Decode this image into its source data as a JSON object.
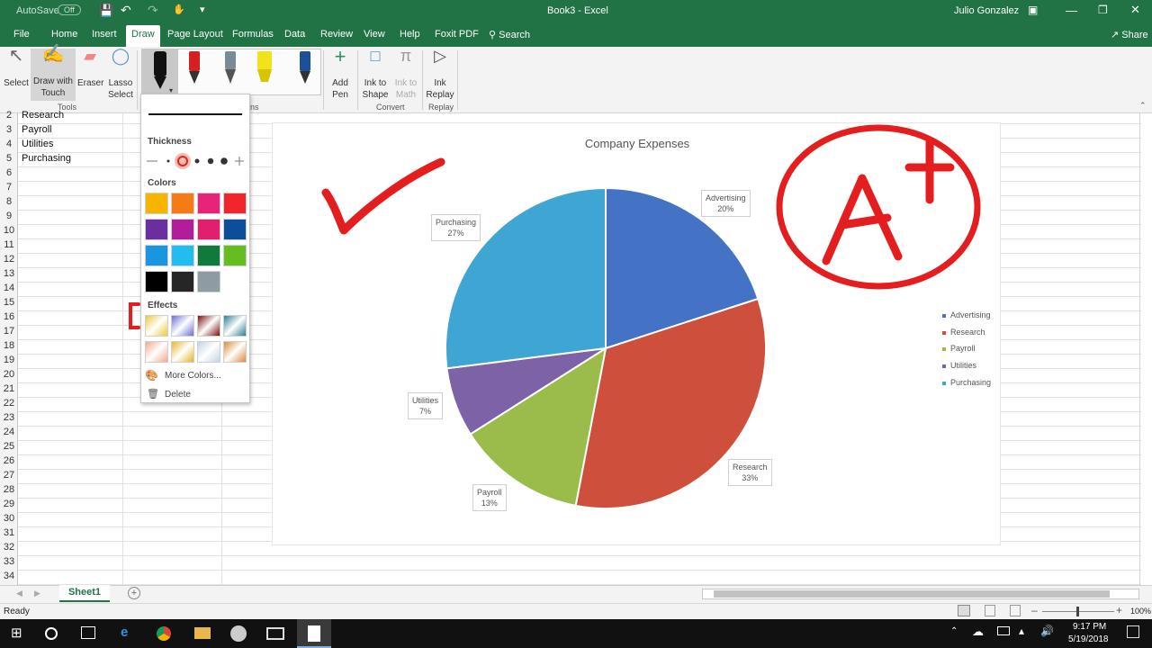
{
  "titlebar": {
    "autosave_label": "AutoSave",
    "autosave_state": "Off",
    "doc_title": "Book3 - Excel",
    "user": "Julio Gonzalez"
  },
  "tabs": [
    "File",
    "Home",
    "Insert",
    "Draw",
    "Page Layout",
    "Formulas",
    "Data",
    "Review",
    "View",
    "Help",
    "Foxit PDF"
  ],
  "search_label": "Search",
  "share_label": "Share",
  "ribbon": {
    "select": "Select",
    "draw_touch": [
      "Draw with",
      "Touch"
    ],
    "eraser": "Eraser",
    "lasso": [
      "Lasso",
      "Select"
    ],
    "tools_group": "Tools",
    "pens_group_fragment": "ns",
    "add_pen": [
      "Add",
      "Pen"
    ],
    "ink_shape": [
      "Ink to",
      "Shape"
    ],
    "ink_math": [
      "Ink to",
      "Math"
    ],
    "ink_replay": [
      "Ink",
      "Replay"
    ],
    "convert_group": "Convert",
    "replay_group": "Replay"
  },
  "pen_dropdown": {
    "thickness_label": "Thickness",
    "colors_label": "Colors",
    "effects_label": "Effects",
    "more_colors": "More Colors...",
    "delete": "Delete",
    "colors": [
      "#f7b500",
      "#f77b14",
      "#e8237a",
      "#f0262a",
      "#6a2f9e",
      "#b21d9c",
      "#e01f6e",
      "#0d4e9a",
      "#1a95e0",
      "#22bdf0",
      "#0f7a3c",
      "#65bd1f",
      "#000000",
      "#262626",
      "#8f9ba2"
    ],
    "effects": [
      "#e9c93a",
      "#6b6fd6",
      "#7a0f12",
      "#2a7f96",
      "#f1a88f",
      "#e6b52a",
      "#c2d3e3",
      "#d98a3b"
    ]
  },
  "rows": {
    "numbers": [
      "2",
      "3",
      "4",
      "5",
      "6",
      "7",
      "8",
      "9",
      "10",
      "11",
      "12",
      "13",
      "14",
      "15",
      "16",
      "17",
      "18",
      "19",
      "20",
      "21",
      "22",
      "23",
      "24",
      "25",
      "26",
      "27",
      "28",
      "29",
      "30",
      "31",
      "32",
      "33",
      "34"
    ],
    "cells": [
      "Research",
      "Payroll",
      "Utilities",
      "Purchasing"
    ]
  },
  "chart_data": {
    "type": "pie",
    "title": "Company Expenses",
    "categories": [
      "Advertising",
      "Research",
      "Payroll",
      "Utilities",
      "Purchasing"
    ],
    "values": [
      20,
      33,
      13,
      7,
      27
    ],
    "value_labels": [
      "20%",
      "33%",
      "13%",
      "7%",
      "27%"
    ],
    "colors": [
      "#4472c4",
      "#cd4f3c",
      "#9bbb4b",
      "#7e62a7",
      "#3fa5d2"
    ],
    "legend_position": "right"
  },
  "sheet_tab": "Sheet1",
  "status": "Ready",
  "zoom": "100%",
  "clock": {
    "time": "9:17 PM",
    "date": "5/19/2018"
  },
  "ink": {
    "mark_text": "A+"
  }
}
